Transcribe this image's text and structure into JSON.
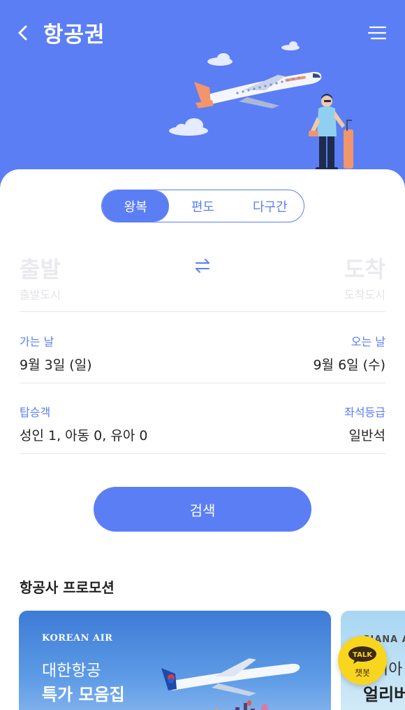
{
  "header": {
    "title": "항공권",
    "back_icon": "chevron-left-icon",
    "menu_icon": "hamburger-menu-icon",
    "background_color": "#5b7ef5"
  },
  "trip_type_tabs": [
    {
      "label": "왕복",
      "active": true
    },
    {
      "label": "편도",
      "active": false
    },
    {
      "label": "다구간",
      "active": false
    }
  ],
  "route": {
    "departure_label": "출발",
    "departure_placeholder": "출발도시",
    "arrival_label": "도착",
    "arrival_placeholder": "도착도시",
    "swap_icon": "swap-arrows-icon"
  },
  "dates": {
    "depart_label": "가는 날",
    "depart_value": "9월 3일 (일)",
    "return_label": "오는 날",
    "return_value": "9월 6일 (수)"
  },
  "passengers": {
    "label": "탑승객",
    "value": "성인 1, 아동 0, 유아 0",
    "class_label": "좌석등급",
    "class_value": "일반석"
  },
  "search_button": {
    "label": "검색"
  },
  "promotions": {
    "title": "항공사 프로모션",
    "cards": [
      {
        "brand": "KOREAN AIR",
        "line1": "대한항공",
        "line2": "특가 모음집"
      },
      {
        "brand": "SIANA A",
        "line1": "시아",
        "line2": "얼리버"
      }
    ]
  },
  "chatbot": {
    "bubble_text": "TALK",
    "label": "챗봇"
  },
  "colors": {
    "accent": "#5b7ef5",
    "chatbot_yellow": "#f8d51e",
    "placeholder": "#e9e9ee"
  }
}
